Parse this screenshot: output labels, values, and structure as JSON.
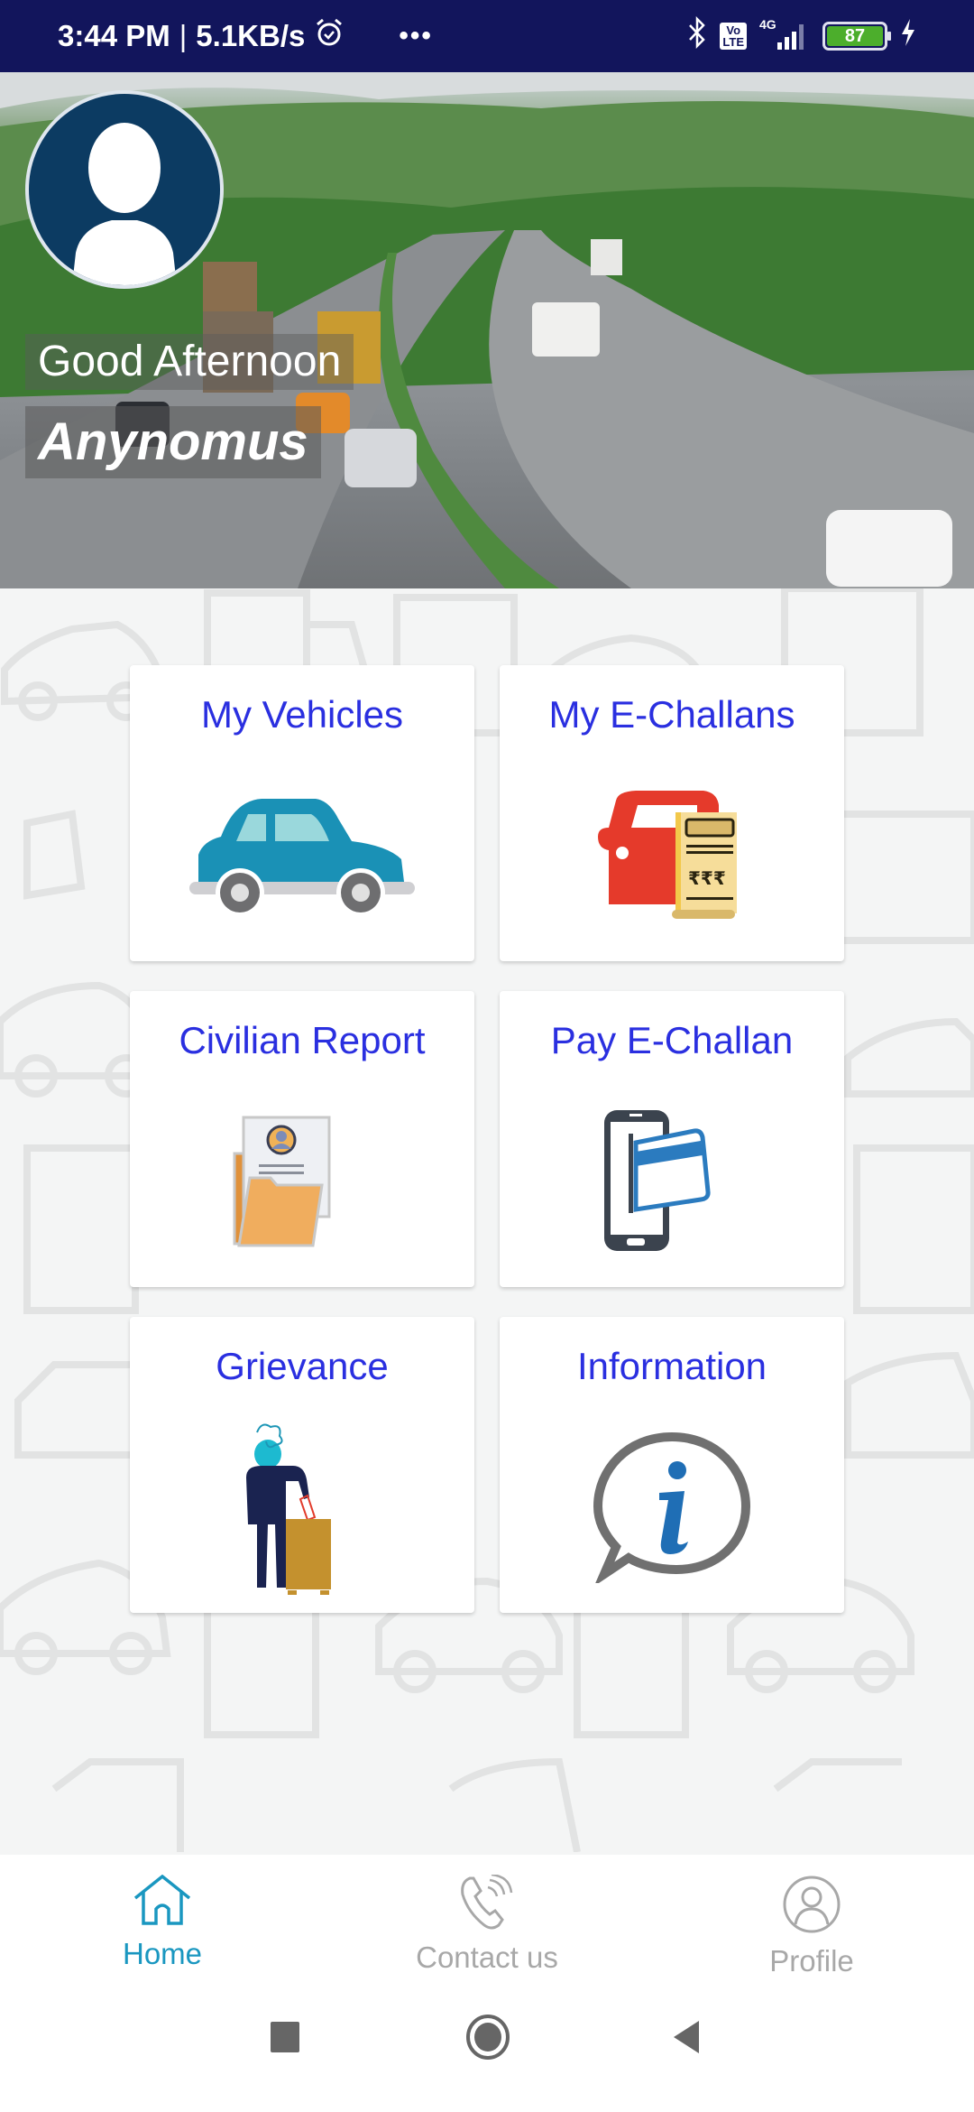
{
  "status_bar": {
    "time": "3:44 PM",
    "network_speed": "5.1KB/s",
    "separator": "|",
    "more": "•••",
    "volte_top": "Vo",
    "volte_bottom": "LTE",
    "network_type": "4G",
    "battery_level": "87",
    "icons": [
      "alarm-icon",
      "bluetooth-icon",
      "volte-icon",
      "signal-icon",
      "battery-icon",
      "charging-icon"
    ]
  },
  "header": {
    "greeting": "Good Afternoon",
    "user_name": "Anynomus",
    "avatar_icon": "user-silhouette-icon"
  },
  "menu": {
    "cards": [
      {
        "label": "My Vehicles",
        "icon": "car-icon"
      },
      {
        "label": "My E-Challans",
        "icon": "challan-receipt-icon"
      },
      {
        "label": "Civilian Report",
        "icon": "report-folder-icon"
      },
      {
        "label": "Pay E-Challan",
        "icon": "phone-card-payment-icon"
      },
      {
        "label": "Grievance",
        "icon": "grievance-person-icon"
      },
      {
        "label": "Information",
        "icon": "info-bubble-icon"
      }
    ]
  },
  "bottom_nav": {
    "items": [
      {
        "label": "Home",
        "icon": "home-icon",
        "active": true
      },
      {
        "label": "Contact us",
        "icon": "phone-icon",
        "active": false
      },
      {
        "label": "Profile",
        "icon": "profile-icon",
        "active": false
      }
    ],
    "active_color": "#1a97c0",
    "inactive_color": "#a8a8a8"
  },
  "system_nav": {
    "buttons": [
      "recents-button",
      "home-button",
      "back-button"
    ]
  },
  "colors": {
    "status_bar": "#12155c",
    "card_title": "#2a2fe0",
    "background": "#f4f5f5"
  }
}
